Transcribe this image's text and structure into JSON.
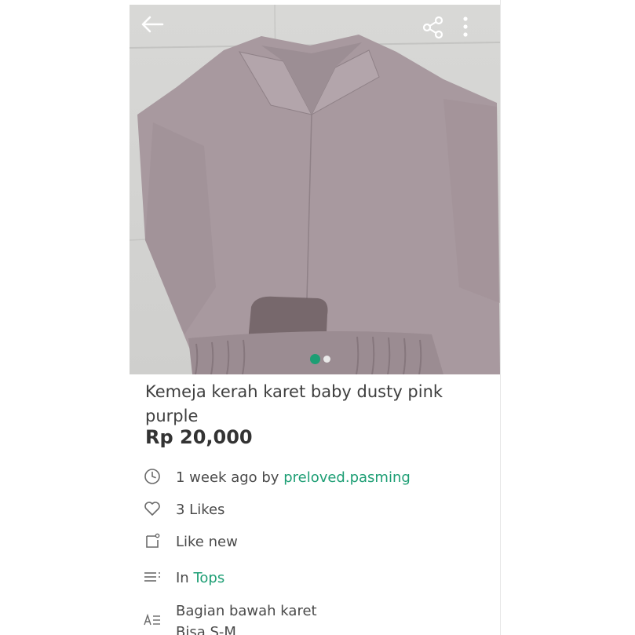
{
  "listing": {
    "title": "Kemeja kerah karet baby dusty pink purple",
    "price": "Rp 20,000",
    "time_ago": "1 week ago by ",
    "seller": "preloved.pasming",
    "likes": "3 Likes",
    "condition": "Like new",
    "category_prefix": "In ",
    "category": "Tops",
    "description_line1": "Bagian bawah karet",
    "description_line2": "Bisa S-M"
  },
  "gallery": {
    "image_count": 2,
    "active_index": 0
  },
  "colors": {
    "accent": "#1d9e74",
    "shirt": "#a8999f",
    "text": "#4a4a4a"
  },
  "icons": [
    "back-arrow-icon",
    "share-icon",
    "more-vertical-icon",
    "clock-icon",
    "heart-icon",
    "tag-icon",
    "list-icon",
    "text-format-icon"
  ]
}
